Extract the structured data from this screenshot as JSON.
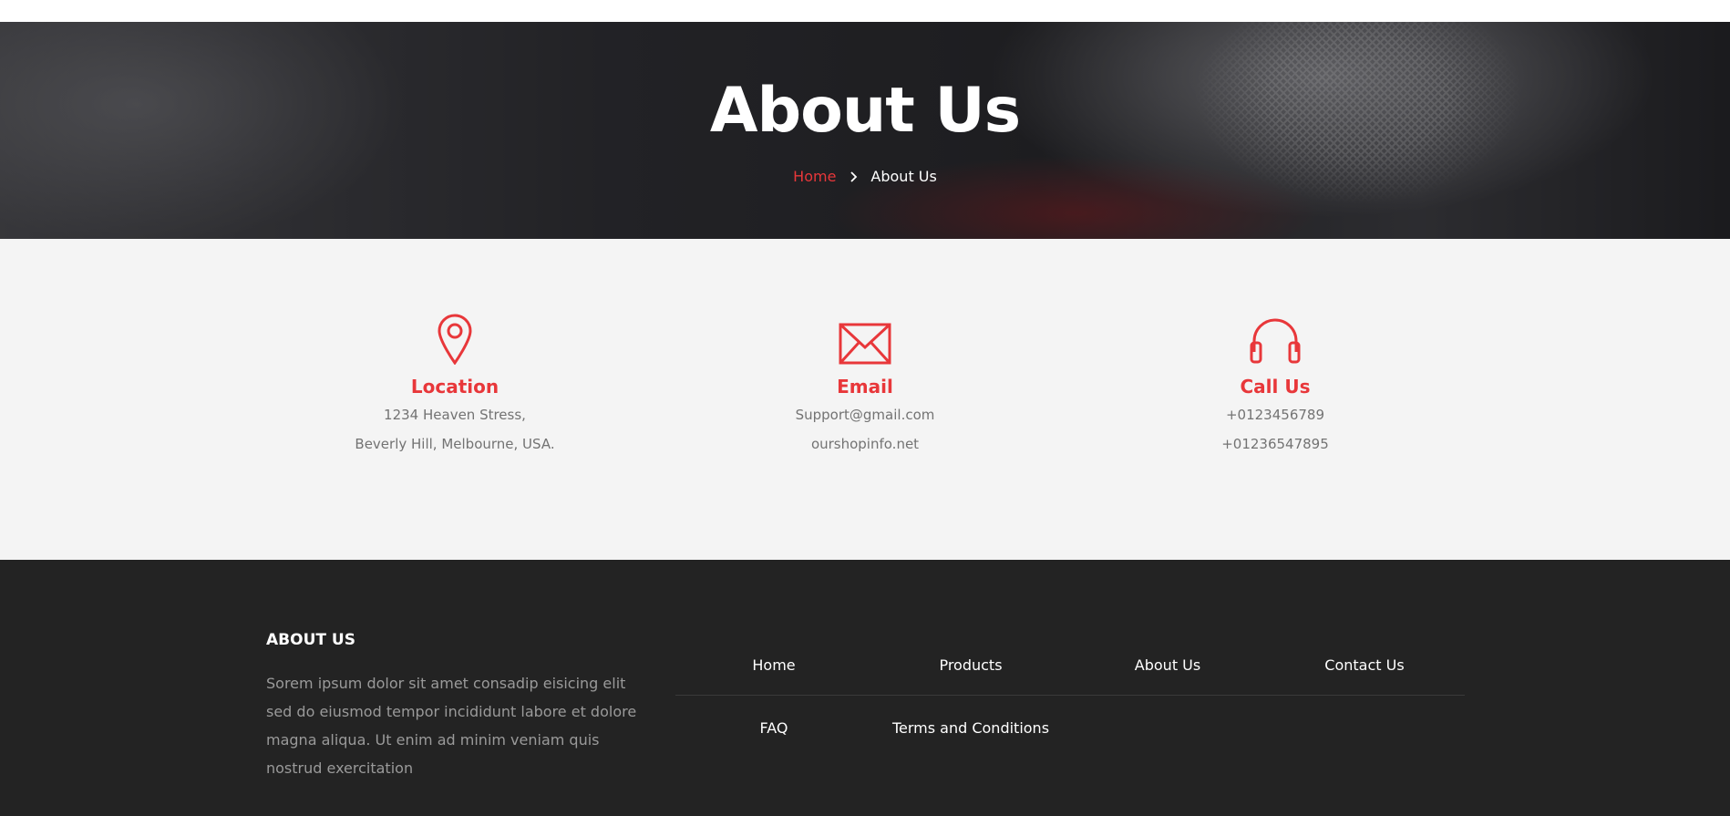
{
  "hero": {
    "title": "About Us",
    "breadcrumb": {
      "home": "Home",
      "current": "About Us"
    }
  },
  "contact": [
    {
      "icon": "location-pin-icon",
      "title": "Location",
      "lines": [
        "1234 Heaven Stress,",
        "Beverly Hill, Melbourne, USA."
      ]
    },
    {
      "icon": "envelope-icon",
      "title": "Email",
      "lines": [
        "Support@gmail.com",
        "ourshopinfo.net"
      ]
    },
    {
      "icon": "headphones-icon",
      "title": "Call Us",
      "lines": [
        "+0123456789",
        "+01236547895"
      ]
    }
  ],
  "footer": {
    "heading": "ABOUT US",
    "text": "Sorem ipsum dolor sit amet consadip eisicing elit sed do eiusmod tempor incididunt labore et dolore magna aliqua. Ut enim ad minim veniam quis nostrud exercitation",
    "links_row1": [
      "Home",
      "Products",
      "About Us",
      "Contact Us"
    ],
    "links_row2": [
      "FAQ",
      "Terms and Conditions"
    ]
  },
  "colors": {
    "accent": "#e8373a",
    "footer_bg": "#232323",
    "section_bg": "#f4f4f4"
  }
}
